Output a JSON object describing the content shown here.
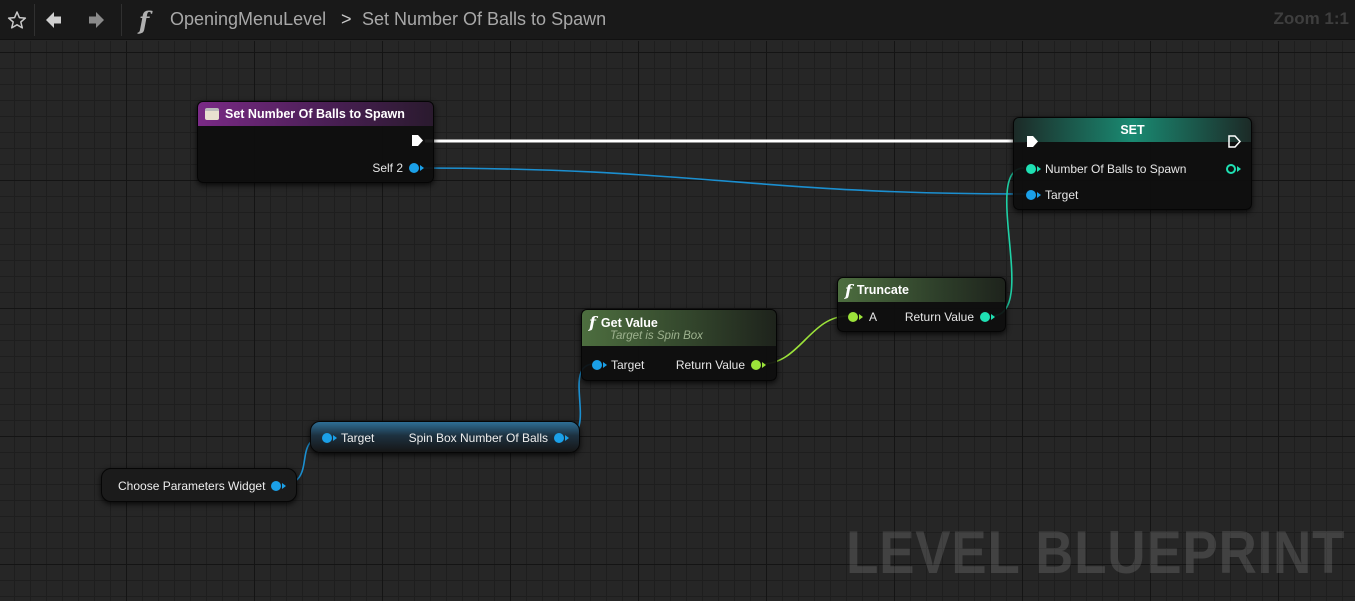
{
  "toolbar": {
    "favorite_icon": "star-icon",
    "back_icon": "arrow-left-icon",
    "forward_icon": "arrow-right-icon",
    "function_icon": "f",
    "breadcrumb_level": "OpeningMenuLevel",
    "breadcrumb_separator": ">",
    "breadcrumb_function": "Set Number Of Balls to Spawn",
    "zoom": "Zoom 1:1"
  },
  "watermark": "LEVEL BLUEPRINT",
  "nodes": {
    "entry": {
      "title": "Set Number Of Balls to Spawn",
      "pin_self": "Self 2"
    },
    "set": {
      "title": "SET",
      "pin_var": "Number Of Balls to Spawn",
      "pin_target": "Target"
    },
    "truncate": {
      "title": "Truncate",
      "pin_a": "A",
      "pin_return": "Return Value"
    },
    "get_value": {
      "title": "Get Value",
      "subtitle": "Target is Spin Box",
      "pin_target": "Target",
      "pin_return": "Return Value"
    },
    "spin_box": {
      "pin_target": "Target",
      "pin_output": "Spin Box Number Of Balls"
    },
    "widget": {
      "label": "Choose Parameters Widget"
    }
  },
  "colors": {
    "exec_wire": "#ffffff",
    "object_pin": "#1ba0e8",
    "float_pin": "#9ce33a",
    "int_pin": "#1fe0b3",
    "entry_header": "#7a2a86",
    "set_header": "#1a8a72",
    "pure_header": "#4d6e3f",
    "variable_header": "#2e6f96"
  }
}
